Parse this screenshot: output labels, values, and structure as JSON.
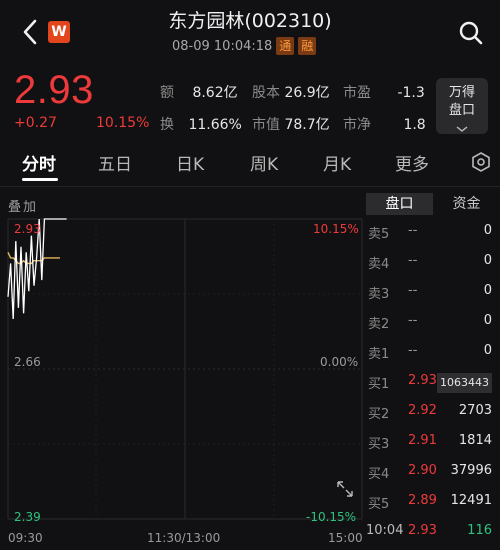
{
  "header": {
    "title": "东方园林(002310)",
    "logo": "W",
    "datetime": "08-09 10:04:18",
    "tag_tong": "通",
    "tag_rong": "融"
  },
  "quote": {
    "price": "2.93",
    "change": "+0.27",
    "change_pct": "10.15%"
  },
  "stats": {
    "amount_label": "额",
    "amount": "8.62亿",
    "share_label": "股本",
    "share": "26.9亿",
    "pe_label": "市盈",
    "pe": "-1.3",
    "turnover_label": "换",
    "turnover": "11.66%",
    "mcap_label": "市值",
    "mcap": "78.7亿",
    "pb_label": "市净",
    "pb": "1.8"
  },
  "wande_button": {
    "line1": "万得",
    "line2": "盘口"
  },
  "tabs": [
    "分时",
    "五日",
    "日K",
    "周K",
    "月K",
    "更多"
  ],
  "overlay_label": "叠加",
  "chart": {
    "y_top": "2.93",
    "y_mid": "2.66",
    "y_bot": "2.39",
    "pct_top": "10.15%",
    "pct_mid": "0.00%",
    "pct_bot": "-10.15%",
    "x_start": "09:30",
    "x_mid": "11:30/13:00",
    "x_end": "15:00"
  },
  "chart_data": {
    "type": "line",
    "series": [
      {
        "values": [
          2.79,
          2.85,
          2.75,
          2.89,
          2.77,
          2.88,
          2.76,
          2.87,
          2.8,
          2.9,
          2.81,
          2.86,
          2.93,
          2.82,
          2.93,
          2.93,
          2.93,
          2.93,
          2.93,
          2.93,
          2.93
        ]
      },
      {
        "values": [
          2.87,
          2.86,
          2.86,
          2.855,
          2.85,
          2.85,
          2.855,
          2.85,
          2.85,
          2.85,
          2.855,
          2.855,
          2.855,
          2.855,
          2.86,
          2.86,
          2.86,
          2.86,
          2.86,
          2.86,
          2.86
        ]
      }
    ],
    "ylim": [
      2.39,
      2.93
    ],
    "colors": {
      "price": "#ffffff",
      "avg": "#e6b55a"
    }
  },
  "right_panel": {
    "tab_active": "盘口",
    "tab_other": "资金",
    "sells": [
      {
        "label": "卖5",
        "price": "--",
        "vol": "0"
      },
      {
        "label": "卖4",
        "price": "--",
        "vol": "0"
      },
      {
        "label": "卖3",
        "price": "--",
        "vol": "0"
      },
      {
        "label": "卖2",
        "price": "--",
        "vol": "0"
      },
      {
        "label": "卖1",
        "price": "--",
        "vol": "0"
      }
    ],
    "buys": [
      {
        "label": "买1",
        "price": "2.93",
        "vol": "1063443"
      },
      {
        "label": "买2",
        "price": "2.92",
        "vol": "2703"
      },
      {
        "label": "买3",
        "price": "2.91",
        "vol": "1814"
      },
      {
        "label": "买4",
        "price": "2.90",
        "vol": "37996"
      },
      {
        "label": "买5",
        "price": "2.89",
        "vol": "12491"
      }
    ],
    "last_time": "10:04",
    "last_price": "2.93",
    "last_vol": "116"
  },
  "colors": {
    "up": "#ee3a3a",
    "down": "#2ec27e",
    "bg": "#111113"
  }
}
